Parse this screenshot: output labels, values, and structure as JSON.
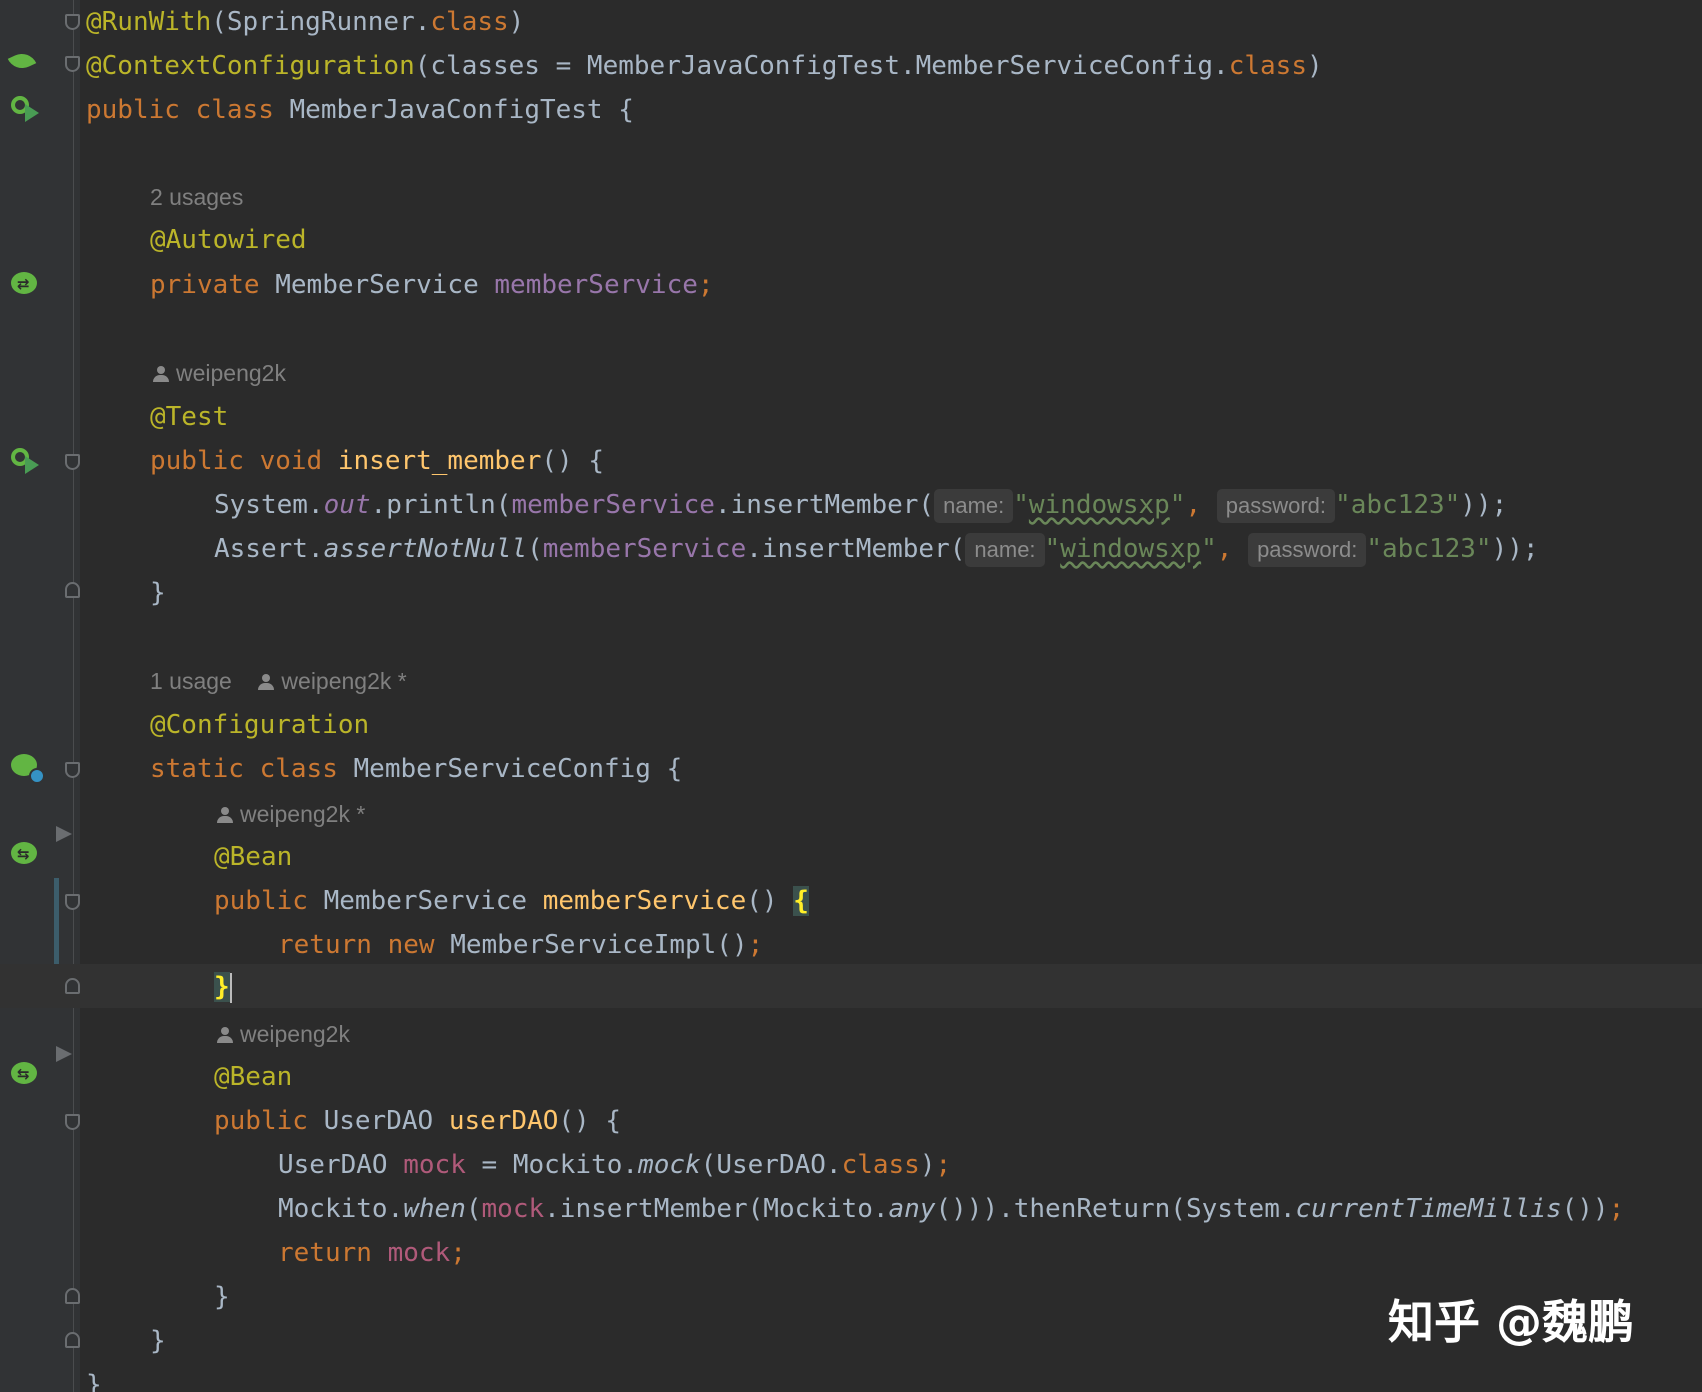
{
  "code": {
    "l1": {
      "a": "@RunWith",
      "b": "(SpringRunner.",
      "c": "class",
      "d": ")"
    },
    "l2": {
      "a": "@ContextConfiguration",
      "b": "(classes = MemberJavaConfigTest.MemberServiceConfig.",
      "c": "class",
      "d": ")"
    },
    "l3": {
      "kw1": "public",
      "kw2": "class",
      "name": "MemberJavaConfigTest {"
    },
    "hint_usages_2": "2 usages",
    "l5": "@Autowired",
    "l6": {
      "kw": "private",
      "type": "MemberService",
      "field": "memberService",
      "semi": ";"
    },
    "hint_author_1": "weipeng2k",
    "l8": "@Test",
    "l9": {
      "kw1": "public",
      "kw2": "void",
      "fn": "insert_member",
      "rest": "() {"
    },
    "l10": {
      "a": "System.",
      "b": "out",
      "c": ".println(",
      "d": "memberService",
      "e": ".insertMember(",
      "p1": "name:",
      "s1": "windowsxp",
      "comma": ",",
      "p2": "password:",
      "s2": "\"abc123\"",
      "end": "));"
    },
    "l11": {
      "a": "Assert.",
      "b": "assertNotNull",
      "c": "(",
      "d": "memberService",
      "e": ".insertMember(",
      "p1": "name:",
      "s1": "windowsxp",
      "comma": ",",
      "p2": "password:",
      "s2": "\"abc123\"",
      "end": "));"
    },
    "l12": "}",
    "hint_usage_1": "1 usage",
    "hint_author_2": "weipeng2k *",
    "l14": "@Configuration",
    "l15": {
      "kw1": "static",
      "kw2": "class",
      "name": "MemberServiceConfig {"
    },
    "hint_author_3": "weipeng2k *",
    "l17": "@Bean",
    "l18": {
      "kw": "public",
      "type": "MemberService",
      "fn": "memberService",
      "paren": "() ",
      "brace": "{"
    },
    "l19": {
      "kw1": "return",
      "kw2": "new",
      "rest": "MemberServiceImpl()",
      "semi": ";"
    },
    "l20": "}",
    "hint_author_4": "weipeng2k",
    "l22": "@Bean",
    "l23": {
      "kw": "public",
      "type": "UserDAO",
      "fn": "userDAO",
      "rest": "() {"
    },
    "l24": {
      "type": "UserDAO",
      "var": "mock",
      "eq": " = Mockito.",
      "m": "mock",
      "c": "(UserDAO.",
      "kw": "class",
      "end": ")",
      "semi": ";"
    },
    "l25": {
      "a": "Mockito.",
      "b": "when",
      "c": "(",
      "d": "mock",
      "e": ".insertMember(Mockito.",
      "f": "any",
      "g": "())).thenReturn(System.",
      "h": "currentTimeMillis",
      "i": "())",
      "semi": ";"
    },
    "l26": {
      "kw": "return",
      "var": "mock",
      "semi": ";"
    },
    "l27": "}",
    "l28": "}",
    "l29": "}"
  },
  "watermark": "知乎 @魏鹏",
  "colors": {
    "background": "#2b2b2b",
    "gutter": "#313335",
    "keyword": "#cc7832",
    "annotation": "#bbb529",
    "field": "#9876aa",
    "method": "#ffc66d",
    "string": "#6a8759",
    "text": "#a9b7c6",
    "hint": "#808080",
    "spring_icon": "#62b543"
  },
  "gutter_icons": [
    "spring-leaf-icon",
    "run-test-class-icon",
    "autowired-bean-icon",
    "run-test-method-icon",
    "configuration-bean-icon",
    "bean-method-icon",
    "bean-method-icon"
  ]
}
